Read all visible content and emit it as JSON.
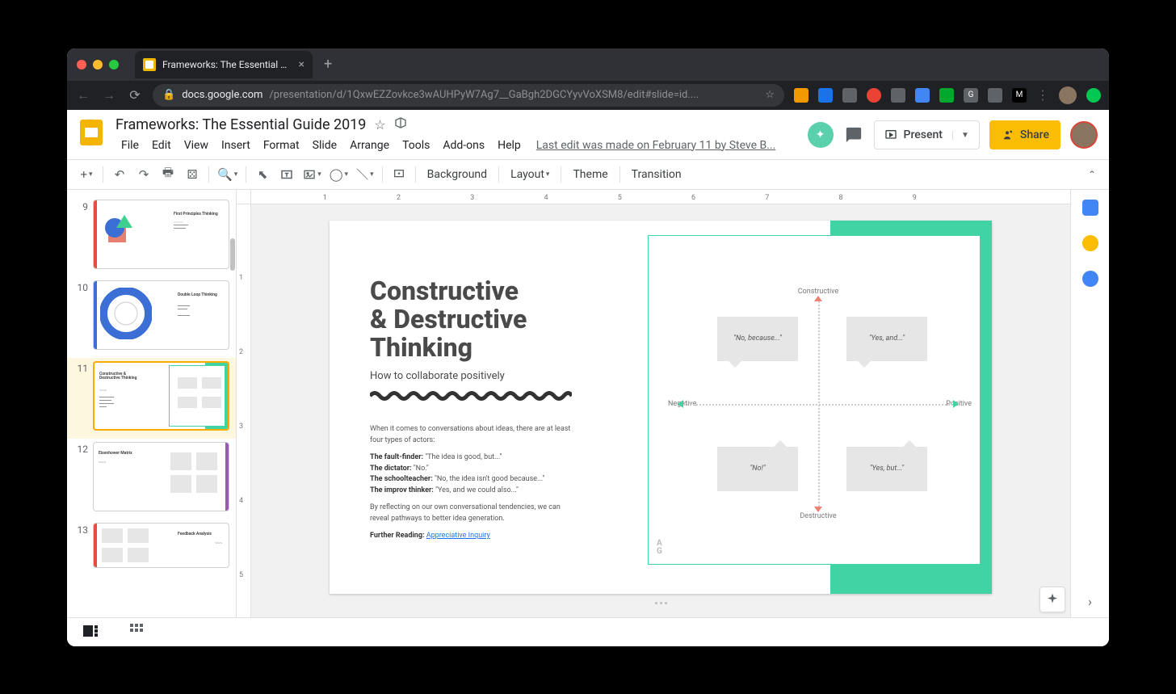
{
  "browser": {
    "tab_title": "Frameworks: The Essential Guide",
    "url_host": "docs.google.com",
    "url_path": "/presentation/d/1QxwEZZovkce3wAUHPyW7Ag7__GaBgh2DGCYyvVoXSM8/edit#slide=id...."
  },
  "app": {
    "doc_title": "Frameworks: The Essential Guide 2019",
    "menus": [
      "File",
      "Edit",
      "View",
      "Insert",
      "Format",
      "Slide",
      "Arrange",
      "Tools",
      "Add-ons",
      "Help"
    ],
    "last_edit": "Last edit was made on February 11 by Steve B...",
    "present_label": "Present",
    "share_label": "Share"
  },
  "toolbar": {
    "background": "Background",
    "layout": "Layout",
    "theme": "Theme",
    "transition": "Transition"
  },
  "thumbs": [
    {
      "n": "9",
      "title": "First Principles Thinking"
    },
    {
      "n": "10",
      "title": "Double Loop Thinking"
    },
    {
      "n": "11",
      "title": "Constructive & Destructive Thinking"
    },
    {
      "n": "12",
      "title": "Eisenhower Matrix"
    },
    {
      "n": "13",
      "title": "Feedback Analysis"
    }
  ],
  "slide": {
    "title_l1": "Constructive",
    "title_l2": "& Destructive",
    "title_l3": "Thinking",
    "subtitle": "How to collaborate positively",
    "body_intro": "When it comes to conversations about ideas, there are at least four types of actors:",
    "actors": {
      "a1_name": "The fault-finder:",
      "a1_quote": " \"The idea is good, but...\"",
      "a2_name": "The dictator:",
      "a2_quote": " \"No.\"",
      "a3_name": "The schoolteacher:",
      "a3_quote": " \"No, the idea isn't good because...\"",
      "a4_name": "The improv thinker:",
      "a4_quote": " \"Yes, and we could also...\""
    },
    "body_outro": "By reflecting on our own conversational tendencies, we can reveal pathways to better idea generation.",
    "further_label": "Further Reading: ",
    "further_link": "Appreciative Inquiry",
    "axis": {
      "top": "Constructive",
      "bottom": "Destructive",
      "left": "Negative",
      "right": "Positive"
    },
    "quads": {
      "q1": "\"No, because...\"",
      "q2": "\"Yes, and...\"",
      "q3": "\"No!\"",
      "q4": "\"Yes, but...\""
    },
    "mark_a": "A",
    "mark_g": "G"
  },
  "ruler_h": [
    "1",
    "2",
    "3",
    "4",
    "5",
    "6",
    "7",
    "8",
    "9"
  ],
  "ruler_v": [
    "1",
    "2",
    "3",
    "4",
    "5"
  ]
}
